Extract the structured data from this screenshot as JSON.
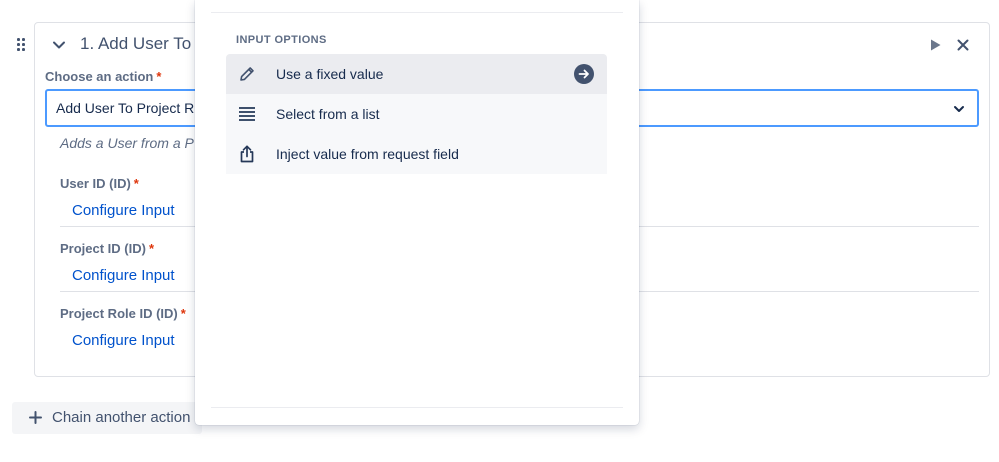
{
  "action_card": {
    "title": "1. Add User To P",
    "choose_label": "Choose an action",
    "required_marker": "*",
    "selected_action": "Add User To Project R",
    "description": "Adds a User from a P",
    "fields": [
      {
        "label": "User ID (ID)",
        "link": "Configure Input"
      },
      {
        "label": "Project ID (ID)",
        "link": "Configure Input"
      },
      {
        "label": "Project Role ID (ID)",
        "link": "Configure Input"
      }
    ]
  },
  "chain_button": {
    "label": "Chain another action",
    "icon": "plus-icon"
  },
  "input_options": {
    "heading": "INPUT OPTIONS",
    "options": [
      {
        "label": "Use a fixed value",
        "icon": "pencil-icon",
        "highlighted": true
      },
      {
        "label": "Select from a list",
        "icon": "list-icon",
        "highlighted": false
      },
      {
        "label": "Inject value from request field",
        "icon": "share-icon",
        "highlighted": false
      }
    ]
  },
  "colors": {
    "link": "#0052cc",
    "required": "#de350b",
    "focus_border": "#4c9aff",
    "arrow_badge": "#42526e"
  }
}
